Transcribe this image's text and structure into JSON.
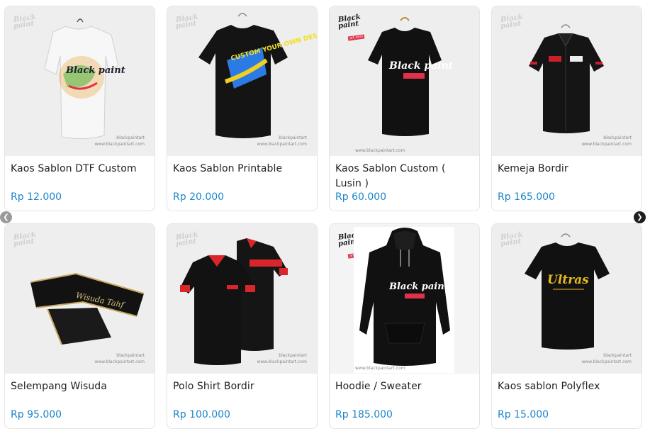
{
  "brand_logo": {
    "line1": "Black",
    "line2": "paint",
    "tag": "art.com"
  },
  "watermark": {
    "handle": "blackpaintart",
    "site": "www.blackpaintart.com"
  },
  "products": [
    {
      "name": "Kaos Sablon DTF Custom",
      "price": "Rp 12.000",
      "shirt_print": "Black paint"
    },
    {
      "name": "Kaos Sablon Printable",
      "price": "Rp 20.000",
      "shirt_print": "CUSTOM YOUR OWN DESIGN"
    },
    {
      "name": "Kaos Sablon Custom ( Lusin )",
      "price": "Rp 60.000",
      "shirt_print": "Black paint"
    },
    {
      "name": "Kemeja Bordir",
      "price": "Rp 165.000"
    },
    {
      "name": "Selempang Wisuda",
      "price": "Rp 95.000",
      "sash_text": "Wisuda Tahf"
    },
    {
      "name": "Polo Shirt Bordir",
      "price": "Rp 100.000"
    },
    {
      "name": "Hoodie / Sweater",
      "price": "Rp 185.000",
      "shirt_print": "Black paint"
    },
    {
      "name": "Kaos sablon Polyflex",
      "price": "Rp 15.000",
      "shirt_print": "Ultras"
    }
  ],
  "nav": {
    "prev_icon": "chevron-left-icon",
    "next_icon": "chevron-right-icon",
    "prev_glyph": "❮",
    "next_glyph": "❯"
  }
}
